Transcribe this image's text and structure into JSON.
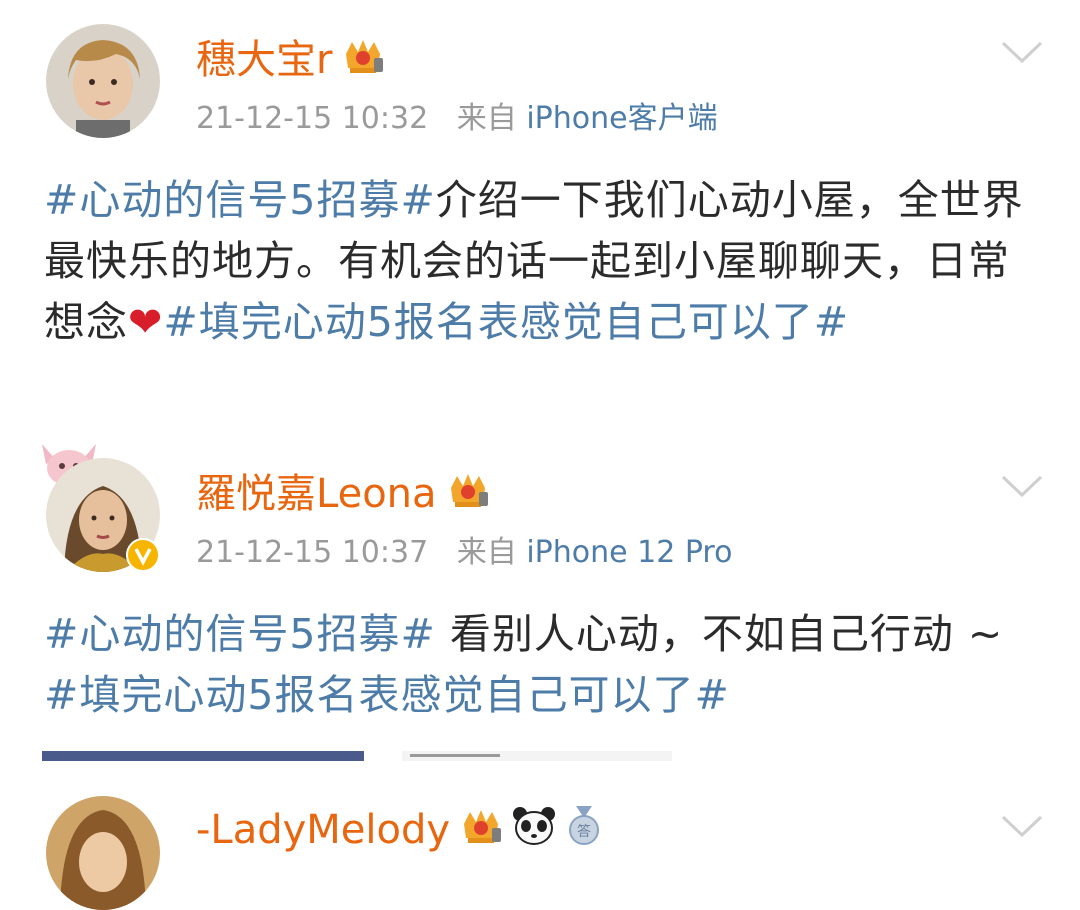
{
  "posts": [
    {
      "username": "穗大宝r",
      "timestamp": "21-12-15 10:32",
      "from_label": "来自",
      "source": "iPhone客户端",
      "segments": [
        {
          "type": "tag",
          "text": "#心动的信号5招募#"
        },
        {
          "type": "text",
          "text": "介绍一下我们心动小屋，全世界最快乐的地方。有机会的话一起到小屋聊聊天，日常想念"
        },
        {
          "type": "heart",
          "text": "❤"
        },
        {
          "type": "tag",
          "text": "#填完心动5报名表感觉自己可以了#"
        }
      ]
    },
    {
      "username": "羅悦嘉Leona",
      "timestamp": "21-12-15 10:37",
      "from_label": "来自",
      "source": "iPhone 12 Pro",
      "segments": [
        {
          "type": "tag",
          "text": "#心动的信号5招募#"
        },
        {
          "type": "text",
          "text": " 看别人心动，不如自己行动 ~ "
        },
        {
          "type": "tag",
          "text": "#填完心动5报名表感觉自己可以了#"
        }
      ]
    },
    {
      "username": "-LadyMelody"
    }
  ],
  "colors": {
    "username": "#e8660f",
    "tag": "#4d7ca8",
    "meta": "#9a9a9a",
    "text": "#2b2b2b",
    "heart": "#d81e2b"
  },
  "icons": [
    "crown-badge-icon",
    "verified-v-icon",
    "chevron-down-icon",
    "panda-icon",
    "medal-icon"
  ]
}
